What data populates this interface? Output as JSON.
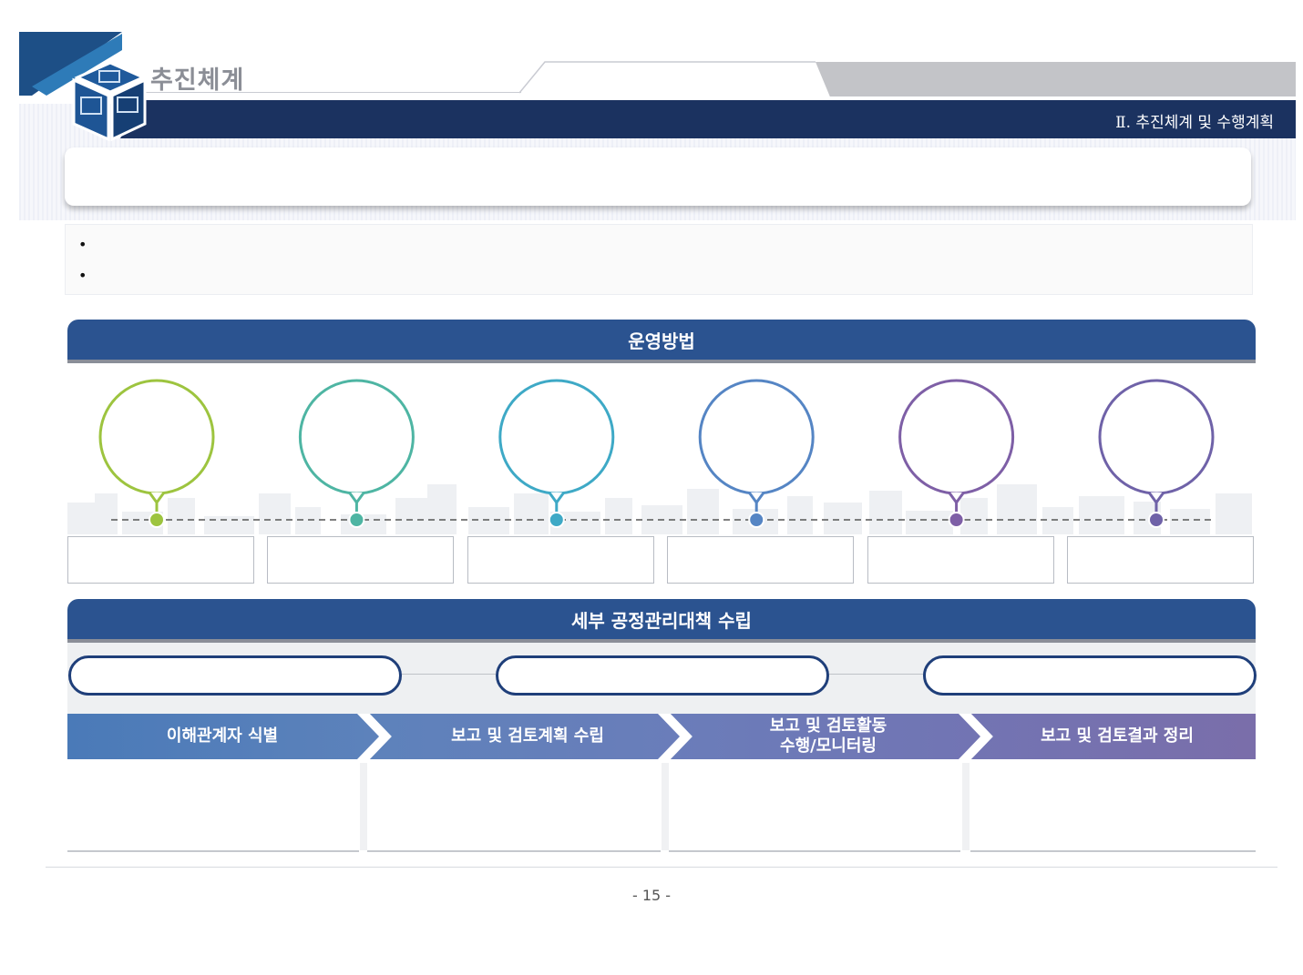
{
  "header": {
    "section_title": "추진체계",
    "chapter_title": "Ⅱ. 추진체계 및 수행계획"
  },
  "bullets": [
    "•",
    "•"
  ],
  "operation": {
    "title": "운영방법",
    "steps": [
      {
        "color": "#9dc43f"
      },
      {
        "color": "#4eb5a3"
      },
      {
        "color": "#3ea9c6"
      },
      {
        "color": "#5585c4"
      },
      {
        "color": "#7e5fa6"
      },
      {
        "color": "#6f62a8"
      }
    ]
  },
  "process": {
    "title": "세부 공정관리대책 수립",
    "chevrons": [
      "이해관계자 식별",
      "보고 및 검토계획 수립",
      "보고 및 검토활동\n수행/모니터링",
      "보고 및 검토결과 정리"
    ]
  },
  "footer": {
    "page_number": "- 15 -"
  },
  "colors": {
    "navy": "#1b3260",
    "section_bar": "#2b5390"
  }
}
